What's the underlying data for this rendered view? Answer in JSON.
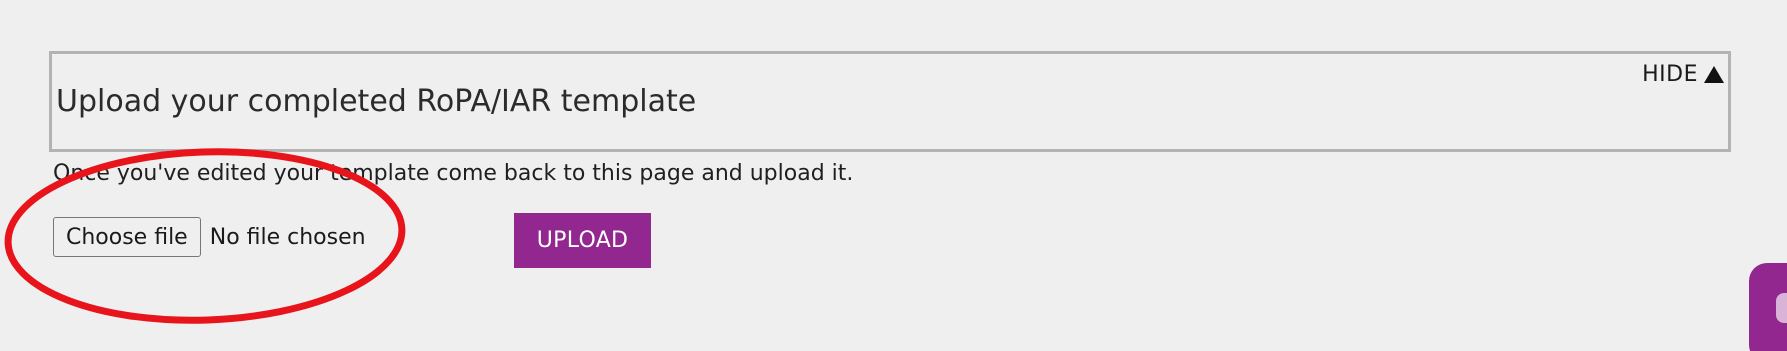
{
  "section": {
    "title": "Upload your completed RoPA/IAR template",
    "hide_label": "HIDE",
    "hide_icon": "triangle-up-icon"
  },
  "instruction": "Once you've edited your template come back to this page and upload it.",
  "file_input": {
    "button_label": "Choose file",
    "status_text": "No file chosen"
  },
  "upload_button": {
    "label": "UPLOAD"
  },
  "colors": {
    "accent": "#92278f",
    "highlight": "#e8141b",
    "page_background": "#efefef",
    "panel_border": "#b3b3b3"
  }
}
